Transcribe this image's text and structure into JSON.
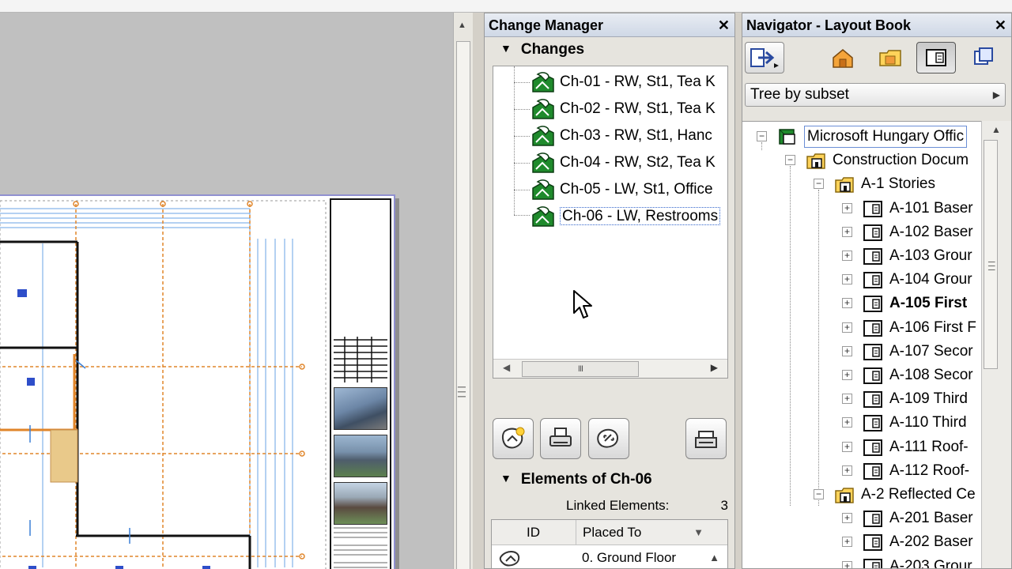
{
  "change_manager": {
    "title": "Change Manager",
    "close": "✕",
    "changes_header": "Changes",
    "changes": [
      {
        "label": "Ch-01 - RW, St1, Tea K"
      },
      {
        "label": "Ch-02 - RW, St1, Tea K"
      },
      {
        "label": "Ch-03 - RW, St1, Hanc"
      },
      {
        "label": "Ch-04 - RW, St2, Tea K"
      },
      {
        "label": "Ch-05 - LW, St1, Office"
      },
      {
        "label": "Ch-06 - LW, Restrooms"
      }
    ],
    "scroll_grip": "III",
    "elements_header": "Elements of Ch-06",
    "linked_label": "Linked Elements:",
    "linked_count": "3",
    "table": {
      "col_id": "ID",
      "col_placed": "Placed To",
      "rows": [
        {
          "placed_to": "0. Ground Floor"
        }
      ]
    }
  },
  "navigator": {
    "title": "Navigator - Layout Book",
    "close": "✕",
    "view_mode": "Tree by subset",
    "tree": [
      {
        "label": "Microsoft Hungary Offic",
        "level": 0
      },
      {
        "label": "Construction Docum",
        "level": 1
      },
      {
        "label": "A-1 Stories",
        "level": 2
      },
      {
        "label": "A-101 Baser",
        "level": 3
      },
      {
        "label": "A-102 Baser",
        "level": 3
      },
      {
        "label": "A-103 Grour",
        "level": 3
      },
      {
        "label": "A-104 Grour",
        "level": 3
      },
      {
        "label": "A-105 First",
        "level": 3
      },
      {
        "label": "A-106 First F",
        "level": 3
      },
      {
        "label": "A-107 Secor",
        "level": 3
      },
      {
        "label": "A-108 Secor",
        "level": 3
      },
      {
        "label": "A-109 Third",
        "level": 3
      },
      {
        "label": "A-110 Third",
        "level": 3
      },
      {
        "label": "A-111 Roof-",
        "level": 3
      },
      {
        "label": "A-112 Roof-",
        "level": 3
      },
      {
        "label": "A-2 Reflected Ce",
        "level": 2
      },
      {
        "label": "A-201 Baser",
        "level": 3
      },
      {
        "label": "A-202 Baser",
        "level": 3
      },
      {
        "label": "A-203 Grour",
        "level": 3
      }
    ]
  },
  "colors": {
    "change_icon": "#1f8a2c",
    "plan_orange": "#e0852a",
    "plan_blue": "#3a7fd6",
    "selection_border": "#6a8ed6"
  }
}
